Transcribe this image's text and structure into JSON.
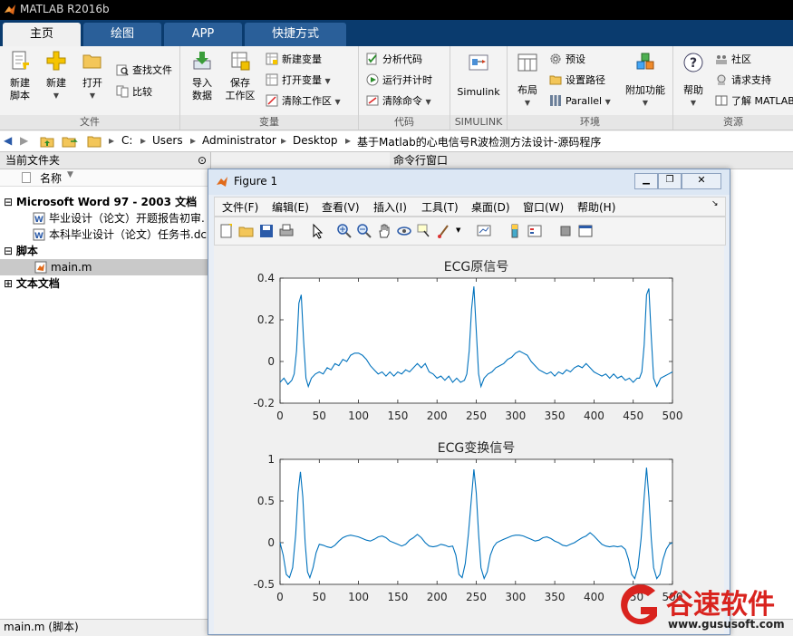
{
  "app": {
    "title": "MATLAB R2016b"
  },
  "tabs": [
    {
      "label": "主页"
    },
    {
      "label": "绘图"
    },
    {
      "label": "APP"
    },
    {
      "label": "快捷方式"
    }
  ],
  "ribbon": {
    "file": {
      "label": "文件",
      "new_script": "新建\n脚本",
      "new": "新建",
      "open": "打开",
      "find_files": "查找文件",
      "compare": "比较"
    },
    "variable": {
      "label": "变量",
      "import": "导入\n数据",
      "save_ws": "保存\n工作区",
      "new_var": "新建变量",
      "open_var": "打开变量",
      "clear_ws": "清除工作区"
    },
    "code": {
      "label": "代码",
      "analyze": "分析代码",
      "run_time": "运行并计时",
      "clear_cmd": "清除命令"
    },
    "simulink": {
      "label": "SIMULINK",
      "btn": "Simulink"
    },
    "env": {
      "label": "环境",
      "layout": "布局",
      "prefs": "预设",
      "set_path": "设置路径",
      "parallel": "Parallel",
      "addons": "附加功能"
    },
    "resources": {
      "label": "资源",
      "help": "帮助",
      "community": "社区",
      "support": "请求支持",
      "learn": "了解 MATLAB"
    }
  },
  "address": {
    "segments": [
      "C:",
      "Users",
      "Administrator",
      "Desktop",
      "基于Matlab的心电信号R波检测方法设计-源码程序"
    ]
  },
  "left_panel": {
    "title": "当前文件夹",
    "col_name": "名称",
    "groups": [
      {
        "label": "Microsoft Word 97 - 2003 文档",
        "items": [
          "毕业设计（论文）开题报告初审.",
          "本科毕业设计（论文）任务书.dc"
        ]
      },
      {
        "label": "脚本",
        "items": [
          "main.m"
        ]
      },
      {
        "label": "文本文档",
        "items": []
      }
    ]
  },
  "cmd_panel": {
    "title": "命令行窗口"
  },
  "status": {
    "text": "main.m  (脚本)"
  },
  "figure": {
    "title": "Figure 1",
    "menu": [
      "文件(F)",
      "编辑(E)",
      "查看(V)",
      "插入(I)",
      "工具(T)",
      "桌面(D)",
      "窗口(W)",
      "帮助(H)"
    ]
  },
  "chart_data": [
    {
      "type": "line",
      "title": "ECG原信号",
      "xlim": [
        0,
        500
      ],
      "ylim": [
        -0.2,
        0.4
      ],
      "xticks": [
        0,
        50,
        100,
        150,
        200,
        250,
        300,
        350,
        400,
        450,
        500
      ],
      "yticks": [
        -0.2,
        0,
        0.2,
        0.4
      ],
      "ytick_labels": [
        "-0.2",
        "0",
        "0.2",
        "0.4"
      ],
      "series": [
        {
          "color": "#0072bd",
          "x": [
            0,
            5,
            10,
            15,
            18,
            21,
            24,
            27,
            30,
            33,
            36,
            40,
            45,
            50,
            55,
            60,
            65,
            70,
            75,
            80,
            85,
            90,
            95,
            100,
            105,
            110,
            115,
            120,
            125,
            130,
            135,
            140,
            145,
            150,
            155,
            160,
            165,
            170,
            175,
            180,
            185,
            190,
            195,
            200,
            205,
            210,
            215,
            220,
            225,
            230,
            235,
            238,
            241,
            244,
            247,
            250,
            253,
            256,
            260,
            265,
            270,
            275,
            280,
            285,
            290,
            295,
            300,
            305,
            310,
            315,
            320,
            325,
            330,
            335,
            340,
            345,
            350,
            355,
            360,
            365,
            370,
            375,
            380,
            385,
            390,
            395,
            400,
            405,
            410,
            415,
            420,
            425,
            430,
            435,
            440,
            445,
            450,
            455,
            458,
            461,
            464,
            467,
            470,
            473,
            476,
            480,
            485,
            490,
            495,
            500
          ],
          "y": [
            -0.1,
            -0.08,
            -0.11,
            -0.09,
            -0.06,
            0.05,
            0.28,
            0.32,
            0.1,
            -0.08,
            -0.12,
            -0.08,
            -0.06,
            -0.05,
            -0.06,
            -0.03,
            -0.04,
            -0.01,
            -0.02,
            0.01,
            0.0,
            0.03,
            0.04,
            0.04,
            0.03,
            0.01,
            -0.02,
            -0.04,
            -0.06,
            -0.05,
            -0.07,
            -0.05,
            -0.07,
            -0.05,
            -0.06,
            -0.04,
            -0.05,
            -0.03,
            -0.01,
            -0.03,
            -0.01,
            -0.05,
            -0.06,
            -0.08,
            -0.07,
            -0.09,
            -0.07,
            -0.1,
            -0.08,
            -0.1,
            -0.09,
            -0.06,
            0.05,
            0.25,
            0.36,
            0.15,
            -0.06,
            -0.12,
            -0.08,
            -0.06,
            -0.05,
            -0.03,
            -0.02,
            -0.01,
            0.01,
            0.02,
            0.04,
            0.05,
            0.04,
            0.03,
            0.0,
            -0.02,
            -0.04,
            -0.05,
            -0.06,
            -0.05,
            -0.07,
            -0.05,
            -0.06,
            -0.04,
            -0.05,
            -0.03,
            -0.02,
            -0.03,
            -0.01,
            -0.03,
            -0.05,
            -0.06,
            -0.07,
            -0.06,
            -0.08,
            -0.06,
            -0.08,
            -0.07,
            -0.09,
            -0.08,
            -0.1,
            -0.08,
            -0.08,
            -0.05,
            0.08,
            0.32,
            0.35,
            0.12,
            -0.08,
            -0.12,
            -0.08,
            -0.07,
            -0.06,
            -0.05
          ]
        }
      ]
    },
    {
      "type": "line",
      "title": "ECG变换信号",
      "xlim": [
        0,
        500
      ],
      "ylim": [
        -0.5,
        1
      ],
      "xticks": [
        0,
        50,
        100,
        150,
        200,
        250,
        300,
        350,
        400,
        450,
        500
      ],
      "yticks": [
        -0.5,
        0,
        0.5,
        1
      ],
      "ytick_labels": [
        "-0.5",
        "0",
        "0.5",
        "1"
      ],
      "series": [
        {
          "color": "#0072bd",
          "x": [
            0,
            4,
            8,
            12,
            16,
            20,
            23,
            26,
            29,
            32,
            35,
            38,
            42,
            46,
            50,
            55,
            60,
            65,
            70,
            75,
            80,
            85,
            90,
            95,
            100,
            105,
            110,
            115,
            120,
            125,
            130,
            135,
            140,
            145,
            150,
            155,
            160,
            165,
            170,
            175,
            180,
            185,
            190,
            195,
            200,
            205,
            210,
            215,
            220,
            224,
            228,
            232,
            236,
            240,
            244,
            247,
            250,
            253,
            256,
            260,
            264,
            268,
            272,
            276,
            280,
            285,
            290,
            295,
            300,
            305,
            310,
            315,
            320,
            325,
            330,
            335,
            340,
            345,
            350,
            355,
            360,
            365,
            370,
            375,
            380,
            385,
            390,
            395,
            400,
            405,
            410,
            415,
            420,
            425,
            430,
            435,
            440,
            444,
            448,
            452,
            456,
            460,
            464,
            467,
            470,
            473,
            476,
            480,
            484,
            488,
            492,
            496,
            500
          ],
          "y": [
            0.0,
            -0.15,
            -0.38,
            -0.42,
            -0.3,
            0.1,
            0.6,
            0.85,
            0.55,
            0.0,
            -0.35,
            -0.42,
            -0.3,
            -0.12,
            -0.02,
            -0.03,
            -0.05,
            -0.06,
            -0.03,
            0.02,
            0.06,
            0.08,
            0.09,
            0.08,
            0.07,
            0.05,
            0.03,
            0.02,
            0.04,
            0.07,
            0.08,
            0.06,
            0.02,
            0.0,
            -0.02,
            -0.04,
            -0.02,
            0.03,
            0.06,
            0.1,
            0.06,
            0.0,
            -0.04,
            -0.05,
            -0.04,
            -0.02,
            -0.03,
            -0.05,
            -0.04,
            -0.15,
            -0.38,
            -0.42,
            -0.25,
            0.1,
            0.55,
            0.88,
            0.6,
            0.1,
            -0.3,
            -0.43,
            -0.35,
            -0.15,
            -0.05,
            0.0,
            0.02,
            0.04,
            0.06,
            0.08,
            0.09,
            0.09,
            0.08,
            0.06,
            0.04,
            0.02,
            0.03,
            0.06,
            0.07,
            0.05,
            0.02,
            0.0,
            -0.03,
            -0.04,
            -0.02,
            0.0,
            0.03,
            0.06,
            0.08,
            0.12,
            0.08,
            0.03,
            -0.02,
            -0.04,
            -0.05,
            -0.04,
            -0.05,
            -0.04,
            -0.08,
            -0.2,
            -0.38,
            -0.43,
            -0.3,
            0.05,
            0.55,
            0.9,
            0.55,
            0.05,
            -0.3,
            -0.43,
            -0.38,
            -0.2,
            -0.08,
            -0.02,
            0.0
          ]
        }
      ]
    }
  ],
  "watermark": {
    "brand": "谷速软件",
    "url": "www.gususoft.com"
  }
}
